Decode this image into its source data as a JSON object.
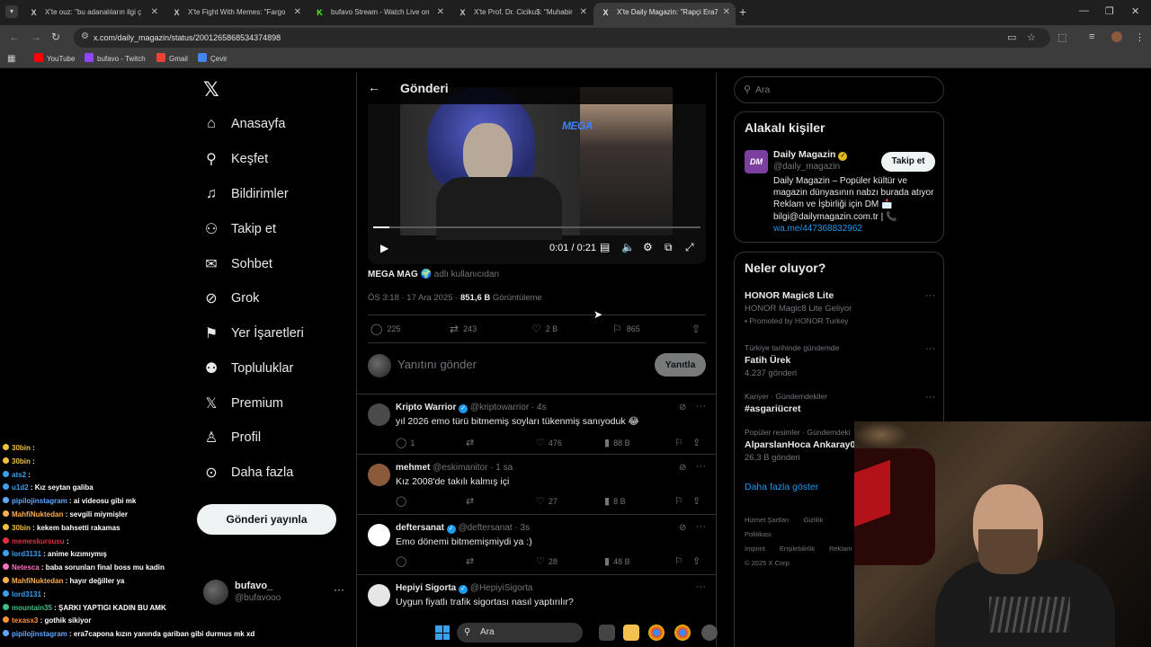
{
  "browser": {
    "tabs": [
      {
        "title": "X'te ouz: \"bu adanalıların ilgi ç",
        "favicon": "X",
        "active": false
      },
      {
        "title": "X'te Fight With Memes: \"Fargo",
        "favicon": "X",
        "active": false
      },
      {
        "title": "bufavo Stream - Watch Live on",
        "favicon": "K",
        "active": false
      },
      {
        "title": "X'te Prof. Dr. Ciciku$: \"Muhabir",
        "favicon": "X",
        "active": false
      },
      {
        "title": "X'te Daily Magazin: \"Rapçi Era7",
        "favicon": "X",
        "active": true
      }
    ],
    "url": "x.com/daily_magazin/status/2001265868534374898",
    "bookmarks": [
      {
        "label": "YouTube",
        "color": "#ff0000"
      },
      {
        "label": "bufavo - Twitch",
        "color": "#9146ff"
      },
      {
        "label": "Gmail",
        "color": "#ea4335"
      },
      {
        "label": "Çevir",
        "color": "#4285f4"
      }
    ]
  },
  "nav": {
    "items": [
      {
        "label": "Anasayfa",
        "icon": "home-icon"
      },
      {
        "label": "Keşfet",
        "icon": "search-icon"
      },
      {
        "label": "Bildirimler",
        "icon": "bell-icon"
      },
      {
        "label": "Takip et",
        "icon": "add-user-icon"
      },
      {
        "label": "Sohbet",
        "icon": "mail-icon"
      },
      {
        "label": "Grok",
        "icon": "grok-icon"
      },
      {
        "label": "Yer İşaretleri",
        "icon": "bookmark-icon"
      },
      {
        "label": "Topluluklar",
        "icon": "communities-icon"
      },
      {
        "label": "Premium",
        "icon": "x-icon"
      },
      {
        "label": "Profil",
        "icon": "user-icon"
      },
      {
        "label": "Daha fazla",
        "icon": "more-circle-icon"
      }
    ],
    "post_button": "Gönderi yayınla",
    "account": {
      "name": "bufavo_",
      "handle": "@bufavooo"
    }
  },
  "main": {
    "title": "Gönderi",
    "video": {
      "watermark": "MEGA",
      "time": "0:01 / 0:21",
      "progress": 0.05
    },
    "source": {
      "name": "MEGA MAG",
      "suffix": "adlı kullanıcıdan"
    },
    "meta": {
      "time": "ÖS 3:18 · 17 Ara 2025 · ",
      "views": "851,6 B",
      "views_label": "Görüntüleme"
    },
    "actions": {
      "replies": "225",
      "reposts": "243",
      "likes": "2 B",
      "bookmarks": "865"
    },
    "reply_placeholder": "Yanıtını gönder",
    "reply_button": "Yanıtla",
    "replies": [
      {
        "name": "Kripto Warrior",
        "handle": "@kriptowarrior · 4s",
        "text": "yıl 2026 emo türü bitmemiş soyları tükenmiş sanıyoduk 😂",
        "replies": "1",
        "reposts": "",
        "likes": "476",
        "views": "88 B",
        "avatar_color": "#4a4a4a"
      },
      {
        "name": "mehmet",
        "handle": "@eskimanitor · 1 sa",
        "text": "Kız 2008'de takılı kalmış içi",
        "replies": "",
        "reposts": "",
        "likes": "27",
        "views": "8 B",
        "avatar_color": "#8a5a3a"
      },
      {
        "name": "deftersanat",
        "handle": "@deftersanat · 3s",
        "text": "Emo dönemi bitmemişmiydi ya :)",
        "replies": "",
        "reposts": "",
        "likes": "28",
        "views": "48 B",
        "avatar_color": "#ffffff"
      },
      {
        "name": "Hepiyi Sigorta",
        "handle": "@HepiyiSigorta",
        "text": "Uygun fiyatlı trafik sigortası nasıl yaptırılır?",
        "replies": "",
        "reposts": "",
        "likes": "",
        "views": "",
        "avatar_color": "#e6e6e6"
      }
    ]
  },
  "right": {
    "search_placeholder": "Ara",
    "related": {
      "title": "Alakalı kişiler",
      "name": "Daily Magazin",
      "handle": "@daily_magazin",
      "follow": "Takip et",
      "bio": "Daily Magazin – Popüler kültür ve magazin dünyasının nabzı burada atıyor Reklam ve İşbirliği için DM 📩 bilgi@dailymagazin.com.tr | 📞",
      "link": "wa.me/447368832962",
      "logo": "DM"
    },
    "trending": {
      "title": "Neler oluyor?",
      "items": [
        {
          "context": "",
          "title": "HONOR Magic8 Lite",
          "sub": "HONOR Magic8 Lite Geliyor",
          "promo": "Promoted by HONOR Turkey"
        },
        {
          "context": "Türkiye tarihinde gündemde",
          "title": "Fatih Ürek",
          "sub": "4.237 gönderi",
          "promo": ""
        },
        {
          "context": "Kariyer · Gündemdekiler",
          "title": "#asgariücret",
          "sub": "",
          "promo": ""
        },
        {
          "context": "Popüler resimler · Gündemdeki",
          "title": "AlparslanHoca Ankaray0",
          "sub": "26,3 B gönderi",
          "promo": ""
        }
      ],
      "show_more": "Daha fazla göster"
    },
    "footer": [
      "Hizmet Şartları",
      "Gizlilik Politikası",
      "Imprint",
      "Erişilebilirlik",
      "Reklam",
      "© 2025 X Corp."
    ]
  },
  "chat": [
    {
      "user": "30bin",
      "text": ":",
      "color": "#f0c040"
    },
    {
      "user": "30bin",
      "text": ":",
      "color": "#f0c040"
    },
    {
      "user": "ats2",
      "text": ":",
      "color": "#3aa0f0"
    },
    {
      "user": "u1d2",
      "text": ": Kız seytan galiba",
      "color": "#3aa0f0"
    },
    {
      "user": "pipilojinstagram",
      "text": ": ai videosu gibi mk",
      "color": "#5fa8ff"
    },
    {
      "user": "MahfiNuktedan",
      "text": ": sevgili miymişler",
      "color": "#ffb050"
    },
    {
      "user": "30bin",
      "text": ": kekem bahsetti rakamas",
      "color": "#f0c040"
    },
    {
      "user": "memeskursusu",
      "text": ":",
      "color": "#e03040"
    },
    {
      "user": "lord3131",
      "text": ": anime kızımıymış",
      "color": "#3aa0f0"
    },
    {
      "user": "Netesca",
      "text": ": baba sorunları final boss mu kadin",
      "color": "#ff70c0"
    },
    {
      "user": "MahfiNuktedan",
      "text": ": hayır değiller ya",
      "color": "#ffb050"
    },
    {
      "user": "lord3131",
      "text": ":",
      "color": "#3aa0f0"
    },
    {
      "user": "mountain35",
      "text": ": ŞARKI YAPTIGI KADIN BU AMK",
      "color": "#40c080"
    },
    {
      "user": "texasx3",
      "text": ": gothik sikiyor",
      "color": "#ff9040"
    },
    {
      "user": "pipilojinstagram",
      "text": ": era7capona kızın yanında gariban gibi durmus mk xd",
      "color": "#5fa8ff"
    }
  ],
  "taskbar": {
    "search": "Ara"
  }
}
